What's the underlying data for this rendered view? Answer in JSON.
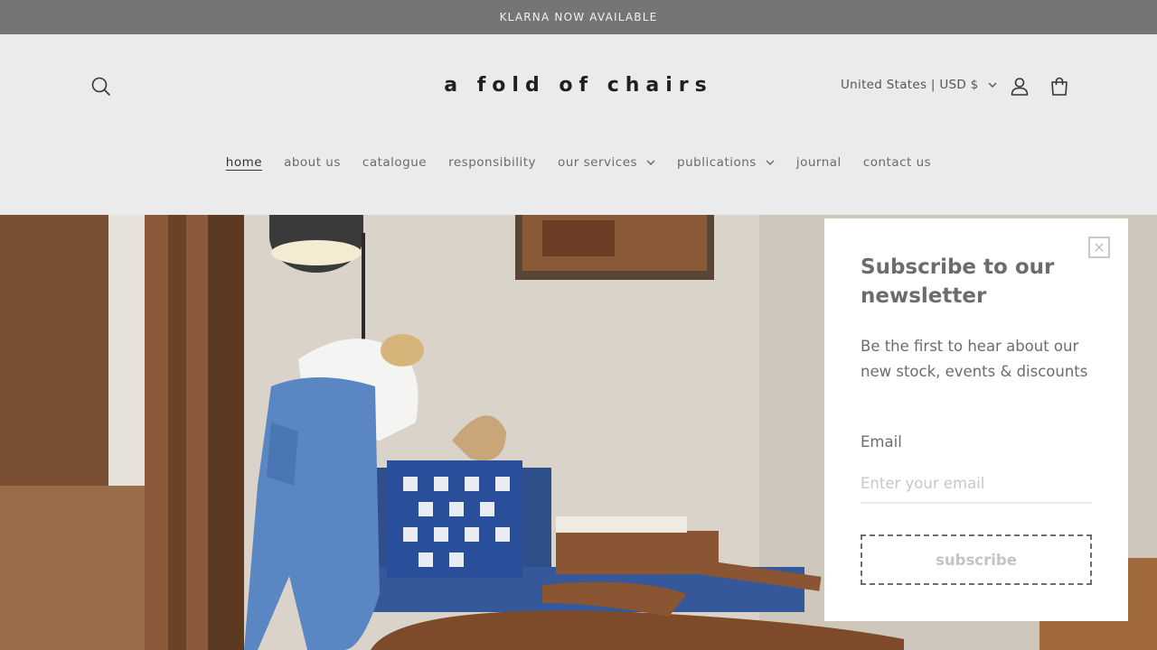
{
  "announcement": {
    "text": "KLARNA NOW AVAILABLE"
  },
  "header": {
    "logo": "a fold of chairs",
    "locale": "United States | USD $",
    "icons": {
      "search": "search-icon",
      "account": "account-icon",
      "cart": "cart-icon"
    }
  },
  "nav": {
    "items": [
      {
        "label": "home",
        "active": true
      },
      {
        "label": "about us"
      },
      {
        "label": "catalogue"
      },
      {
        "label": "responsibility"
      },
      {
        "label": "our services",
        "dropdown": true
      },
      {
        "label": "publications",
        "dropdown": true
      },
      {
        "label": "journal"
      },
      {
        "label": "contact us"
      }
    ]
  },
  "popup": {
    "title": "Subscribe to our newsletter",
    "text": "Be the first to hear about our new stock, events & discounts",
    "email_label": "Email",
    "email_placeholder": "Enter your email",
    "email_value": "",
    "subscribe_label": "subscribe"
  },
  "colors": {
    "announcement_bg": "#757575",
    "header_bg": "#ebebeb",
    "popup_bg": "#ffffff"
  }
}
